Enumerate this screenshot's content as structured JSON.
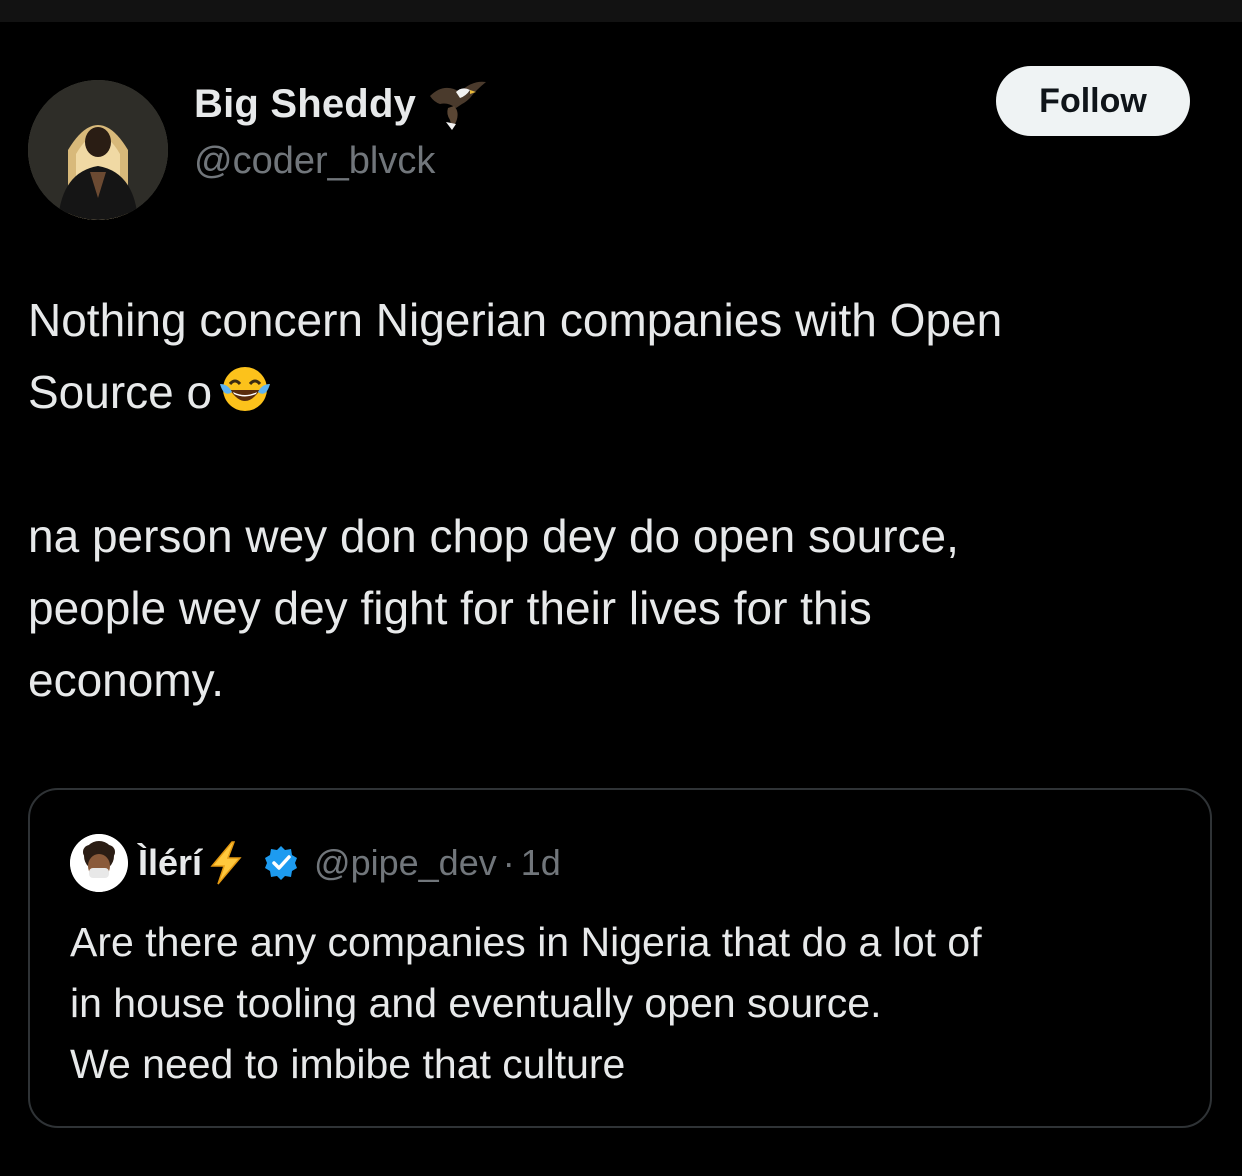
{
  "author": {
    "display_name": "Big Sheddy",
    "name_badge_icon": "eagle-icon",
    "handle": "@coder_blvck",
    "avatar": "avatar-photo"
  },
  "follow_button": {
    "label": "Follow"
  },
  "tweet": {
    "paragraph1_line1": "Nothing concern Nigerian companies with Open",
    "paragraph1_line2": "Source o",
    "paragraph1_emoji": "face-with-tears-of-joy-emoji",
    "paragraph2_line1": "na person wey don chop dey do open source,",
    "paragraph2_line2": "people wey dey fight for their lives for this",
    "paragraph2_line3": "economy."
  },
  "quoted_tweet": {
    "display_name": "Ìlérí",
    "name_badge_icon": "lightning-bolt-icon",
    "verified_icon": "verified-badge-icon",
    "handle": "@pipe_dev",
    "separator": "·",
    "time": "1d",
    "line1": "Are there any companies in Nigeria that do a lot of",
    "line2": "in house tooling and eventually open source.",
    "line3": "We need to imbibe that culture"
  },
  "colors": {
    "background": "#000000",
    "text_primary": "#e7e9ea",
    "text_secondary": "#71767b",
    "border": "#2f3336",
    "follow_bg": "#eff3f4",
    "verified_blue": "#1d9bf0",
    "bolt_yellow": "#ffc83d"
  }
}
